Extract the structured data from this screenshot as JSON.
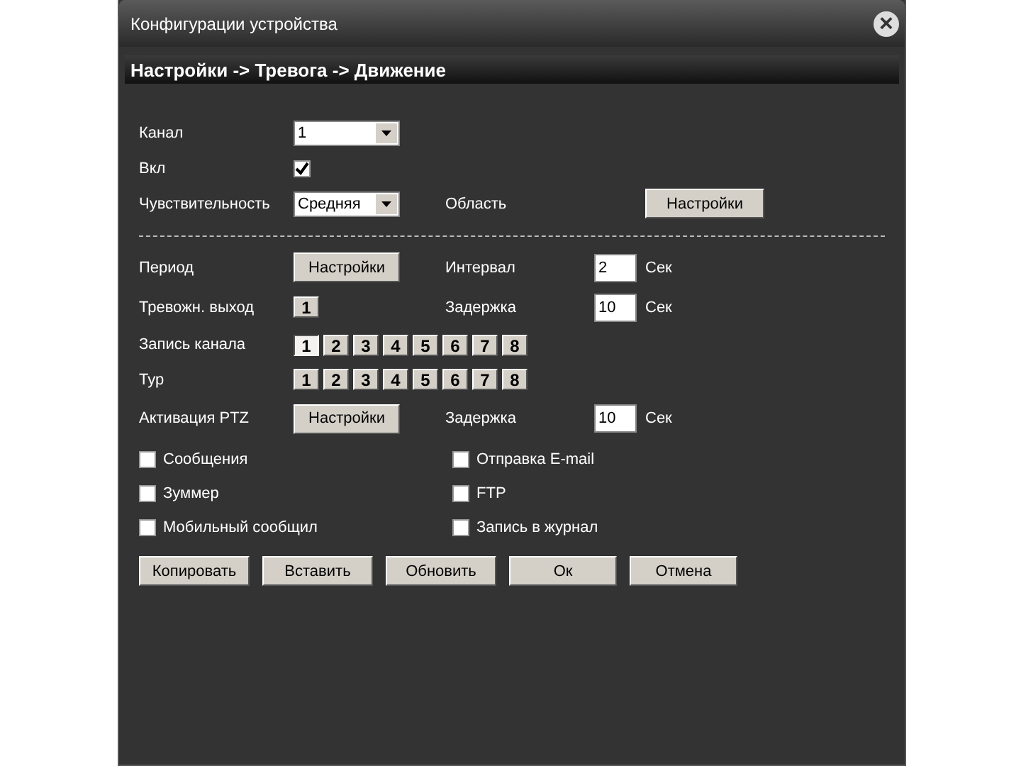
{
  "window": {
    "title": "Конфигурации устройства",
    "close": "×"
  },
  "breadcrumb": "Настройки -> Тревога -> Движение",
  "channel": {
    "label": "Канал",
    "value": "1"
  },
  "enable": {
    "label": "Вкл",
    "checked": true
  },
  "sensitivity": {
    "label": "Чувствительность",
    "value": "Средняя"
  },
  "area": {
    "label": "Область",
    "button": "Настройки"
  },
  "period": {
    "label": "Период",
    "button": "Настройки"
  },
  "interval": {
    "label": "Интервал",
    "value": "2",
    "unit": "Сек"
  },
  "alarm_output": {
    "label": "Тревожн. выход",
    "items": [
      {
        "label": "1",
        "selected": false
      }
    ]
  },
  "delay": {
    "label": "Задержка",
    "value": "10",
    "unit": "Сек"
  },
  "record_channel": {
    "label": "Запись канала",
    "items": [
      {
        "label": "1",
        "selected": true
      },
      {
        "label": "2",
        "selected": false
      },
      {
        "label": "3",
        "selected": false
      },
      {
        "label": "4",
        "selected": false
      },
      {
        "label": "5",
        "selected": false
      },
      {
        "label": "6",
        "selected": false
      },
      {
        "label": "7",
        "selected": false
      },
      {
        "label": "8",
        "selected": false
      }
    ]
  },
  "tour": {
    "label": "Тур",
    "items": [
      {
        "label": "1",
        "selected": false
      },
      {
        "label": "2",
        "selected": false
      },
      {
        "label": "3",
        "selected": false
      },
      {
        "label": "4",
        "selected": false
      },
      {
        "label": "5",
        "selected": false
      },
      {
        "label": "6",
        "selected": false
      },
      {
        "label": "7",
        "selected": false
      },
      {
        "label": "8",
        "selected": false
      }
    ]
  },
  "ptz": {
    "label": "Активация PTZ",
    "button": "Настройки"
  },
  "ptz_delay": {
    "label": "Задержка",
    "value": "10",
    "unit": "Сек"
  },
  "options": [
    {
      "label": "Сообщения",
      "checked": false
    },
    {
      "label": "Отправка E-mail",
      "checked": false
    },
    {
      "label": "Зуммер",
      "checked": false
    },
    {
      "label": "FTP",
      "checked": false
    },
    {
      "label": "Мобильный сообщил",
      "checked": false
    },
    {
      "label": "Запись в журнал",
      "checked": false
    }
  ],
  "buttons": [
    "Копировать",
    "Вставить",
    "Обновить",
    "Ок",
    "Отмена"
  ]
}
